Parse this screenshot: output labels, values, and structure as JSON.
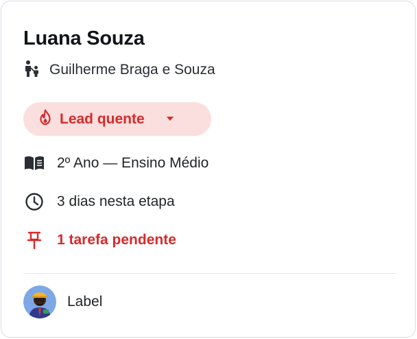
{
  "card": {
    "student_name": "Luana Souza",
    "guardian_name": "Guilherme Braga e Souza",
    "lead_status": {
      "label": "Lead quente",
      "icon": "fire-icon",
      "color": "#d72a2a",
      "background": "#fbdede"
    },
    "details": [
      {
        "icon": "book-icon",
        "text": "2º Ano — Ensino Médio"
      },
      {
        "icon": "clock-icon",
        "text": "3 dias nesta etapa"
      },
      {
        "icon": "pin-icon",
        "text": "1 tarefa pendente",
        "color": "#d72a2a"
      }
    ],
    "footer": {
      "avatar_icon": "avatar",
      "label": "Label"
    }
  }
}
